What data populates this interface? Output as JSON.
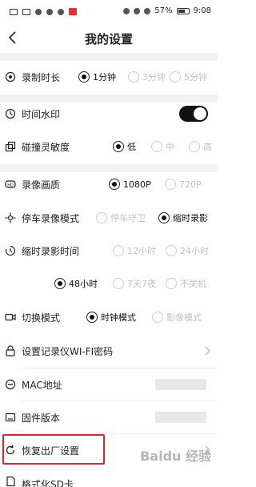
{
  "status_bar": {
    "battery": "57%",
    "time": "9:08"
  },
  "nav": {
    "title": "我的设置"
  },
  "settings": {
    "record_duration": {
      "label": "录制时长",
      "options": [
        "1分钟",
        "3分钟",
        "5分钟"
      ],
      "selected": "1分钟"
    },
    "time_watermark": {
      "label": "时间水印",
      "enabled": true
    },
    "collision_sensitivity": {
      "label": "碰撞灵敏度",
      "options": [
        "低",
        "中",
        "高"
      ],
      "selected": "低"
    },
    "video_quality": {
      "label": "录像画质",
      "options": [
        "1080P",
        "720P"
      ],
      "selected": "1080P"
    },
    "parking_mode": {
      "label": "停车录像模式",
      "options": [
        "停车守卫",
        "缩时录影"
      ],
      "selected": "缩时录影"
    },
    "timelapse_duration": {
      "label": "缩时录影时间",
      "options": [
        "12小时",
        "24小时",
        "48小时",
        "7天7夜",
        "不关机"
      ],
      "selected": "48小时"
    },
    "switch_mode": {
      "label": "切换模式",
      "options": [
        "时钟模式",
        "影像模式"
      ],
      "selected": "时钟模式"
    },
    "wifi_password": {
      "label": "设置记录仪WI-FI密码"
    },
    "mac_address": {
      "label": "MAC地址"
    },
    "firmware_version": {
      "label": "固件版本"
    },
    "factory_reset": {
      "label": "恢复出厂设置"
    },
    "format_sd": {
      "label": "格式化SD卡"
    }
  },
  "watermark": "Baidu 经验",
  "colors": {
    "highlight": "#e3222a",
    "toggle_on": "#111111",
    "section_gap": "#f2f2f2",
    "disabled_text": "#c2c2c2"
  }
}
